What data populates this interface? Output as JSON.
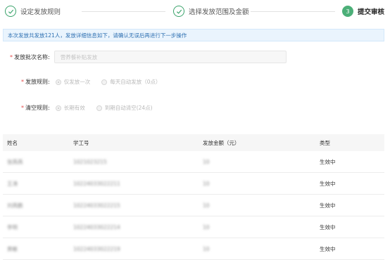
{
  "steps": [
    {
      "label": "设定发放规则",
      "state": "done"
    },
    {
      "label": "选择发放范围及金额",
      "state": "done"
    },
    {
      "label": "提交审核",
      "number": "3",
      "state": "active"
    }
  ],
  "alert": {
    "text": "本次发放共发放121人，发放详细信息如下，请确认无误后再进行下一步操作"
  },
  "form": {
    "batch_name": {
      "label": "发放批次名称:",
      "placeholder": "营养餐补贴发放"
    },
    "issue_rule": {
      "label": "发放规则:",
      "options": [
        "仅发放一次",
        "每天自动发放（0点）"
      ],
      "selected": "仅发放一次"
    },
    "clear_rule": {
      "label": "清空规则:",
      "options": [
        "长期有效",
        "到期自动清空(24点)"
      ],
      "selected": "长期有效"
    }
  },
  "table": {
    "headers": [
      "姓名",
      "学工号",
      "发放金额（元）",
      "类型"
    ],
    "rows": [
      {
        "name": "张燕燕",
        "id": "1021023215",
        "amount": "10",
        "type": "生效中"
      },
      {
        "name": "王涛",
        "id": "10224033022211",
        "amount": "10",
        "type": "生效中"
      },
      {
        "name": "刘燕鹏",
        "id": "10224033022215",
        "amount": "10",
        "type": "生效中"
      },
      {
        "name": "李明",
        "id": "10224033022214",
        "amount": "10",
        "type": "生效中"
      },
      {
        "name": "黄敏",
        "id": "10224033022219",
        "amount": "10",
        "type": "生效中"
      }
    ]
  },
  "colors": {
    "accent": "#4caf78",
    "alert_bg": "#eaf4fd",
    "alert_text": "#2d6fb1",
    "required": "#e34d4d"
  },
  "icons": {
    "done_step": "check-icon"
  }
}
